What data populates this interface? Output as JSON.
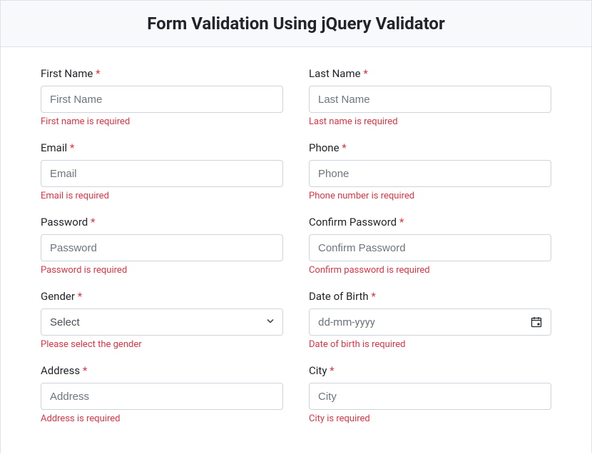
{
  "header": {
    "title": "Form Validation Using jQuery Validator"
  },
  "fields": {
    "firstName": {
      "label": "First Name",
      "placeholder": "First Name",
      "error": "First name is required"
    },
    "lastName": {
      "label": "Last Name",
      "placeholder": "Last Name",
      "error": "Last name is required"
    },
    "email": {
      "label": "Email",
      "placeholder": "Email",
      "error": "Email is required"
    },
    "phone": {
      "label": "Phone",
      "placeholder": "Phone",
      "error": "Phone number is required"
    },
    "password": {
      "label": "Password",
      "placeholder": "Password",
      "error": "Password is required"
    },
    "confirmPassword": {
      "label": "Confirm Password",
      "placeholder": "Confirm Password",
      "error": "Confirm password is required"
    },
    "gender": {
      "label": "Gender",
      "selected": "Select",
      "error": "Please select the gender"
    },
    "dob": {
      "label": "Date of Birth",
      "placeholder": "dd-mm-yyyy",
      "error": "Date of birth is required"
    },
    "address": {
      "label": "Address",
      "placeholder": "Address",
      "error": "Address is required"
    },
    "city": {
      "label": "City",
      "placeholder": "City",
      "error": "City is required"
    }
  },
  "requiredMark": "*"
}
